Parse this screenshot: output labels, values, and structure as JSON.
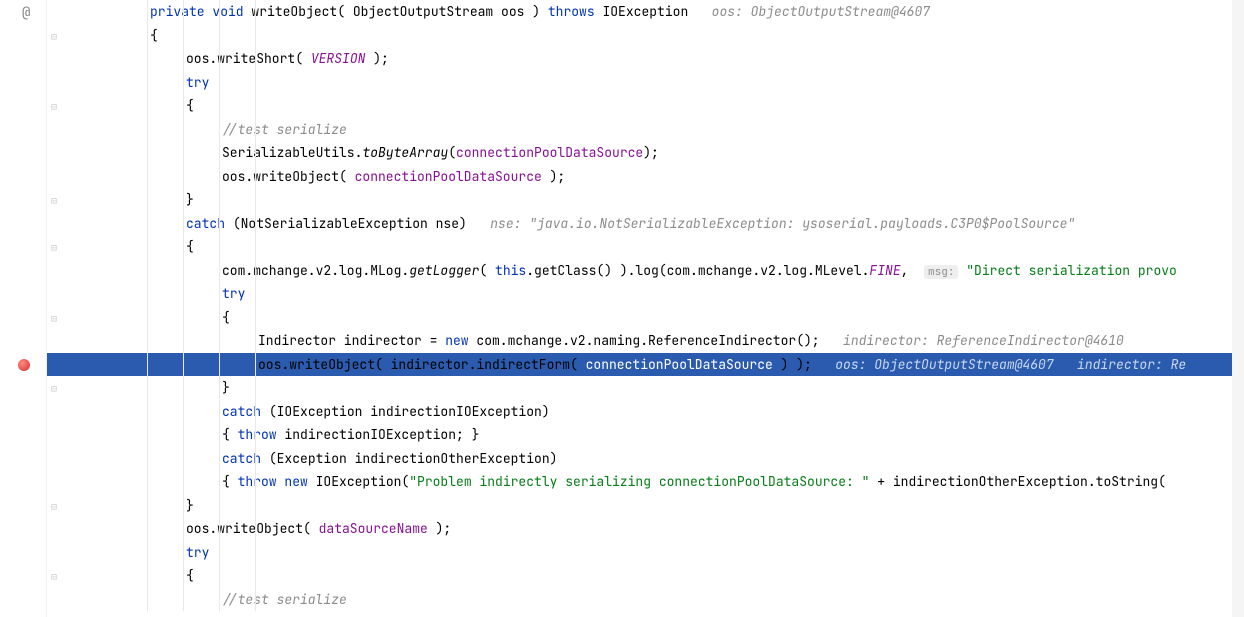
{
  "editor": {
    "lineHeight": 23.5,
    "highlightedLineIndex": 15,
    "breakpointLineIndex": 15,
    "overrideIconLineIndex": 0,
    "foldMarkerLines": [
      1,
      4,
      8,
      10,
      13,
      16,
      21,
      24
    ],
    "lines": [
      {
        "indent": 2,
        "segments": [
          {
            "t": "private ",
            "c": "kw"
          },
          {
            "t": "void ",
            "c": "kw"
          },
          {
            "t": "writeObject",
            "c": "txt"
          },
          {
            "t": "( ObjectOutputStream oos ) ",
            "c": "txt"
          },
          {
            "t": "throws ",
            "c": "kw"
          },
          {
            "t": "IOException   ",
            "c": "txt"
          },
          {
            "t": "oos: ObjectOutputStream@4607",
            "c": "inline-hint"
          }
        ]
      },
      {
        "indent": 2,
        "segments": [
          {
            "t": "{",
            "c": "txt"
          }
        ]
      },
      {
        "indent": 3,
        "segments": [
          {
            "t": "oos.writeShort( ",
            "c": "txt"
          },
          {
            "t": "VERSION",
            "c": "fld-static"
          },
          {
            "t": " );",
            "c": "txt"
          }
        ]
      },
      {
        "indent": 3,
        "segments": [
          {
            "t": "try",
            "c": "kw"
          }
        ]
      },
      {
        "indent": 3,
        "segments": [
          {
            "t": "{",
            "c": "txt"
          }
        ]
      },
      {
        "indent": 4,
        "segments": [
          {
            "t": "//test serialize",
            "c": "cmt"
          }
        ]
      },
      {
        "indent": 4,
        "segments": [
          {
            "t": "SerializableUtils.",
            "c": "txt"
          },
          {
            "t": "toByteArray",
            "c": "mth-static"
          },
          {
            "t": "(",
            "c": "txt"
          },
          {
            "t": "connectionPoolDataSource",
            "c": "fld"
          },
          {
            "t": ");",
            "c": "txt"
          }
        ]
      },
      {
        "indent": 4,
        "segments": [
          {
            "t": "oos.writeObject( ",
            "c": "txt"
          },
          {
            "t": "connectionPoolDataSource",
            "c": "fld"
          },
          {
            "t": " );",
            "c": "txt"
          }
        ]
      },
      {
        "indent": 3,
        "segments": [
          {
            "t": "}",
            "c": "txt"
          }
        ]
      },
      {
        "indent": 3,
        "segments": [
          {
            "t": "catch ",
            "c": "kw"
          },
          {
            "t": "(NotSerializableException nse)   ",
            "c": "txt"
          },
          {
            "t": "nse: \"java.io.NotSerializableException: ysoserial.payloads.C3P0$PoolSource\"",
            "c": "inline-hint"
          }
        ]
      },
      {
        "indent": 3,
        "segments": [
          {
            "t": "{",
            "c": "txt"
          }
        ]
      },
      {
        "indent": 4,
        "segments": [
          {
            "t": "com.mchange.v2.log.MLog.",
            "c": "txt"
          },
          {
            "t": "getLogger",
            "c": "mth-static"
          },
          {
            "t": "( ",
            "c": "txt"
          },
          {
            "t": "this",
            "c": "kw"
          },
          {
            "t": ".getClass() ).log(com.mchange.v2.log.MLevel.",
            "c": "txt"
          },
          {
            "t": "FINE",
            "c": "fld-static"
          },
          {
            "t": ",  ",
            "c": "txt"
          },
          {
            "t": "msg:",
            "c": "param-hint"
          },
          {
            "t": " ",
            "c": "txt"
          },
          {
            "t": "\"Direct serialization provo",
            "c": "str"
          }
        ]
      },
      {
        "indent": 4,
        "segments": [
          {
            "t": "try",
            "c": "kw"
          }
        ]
      },
      {
        "indent": 4,
        "segments": [
          {
            "t": "{",
            "c": "txt"
          }
        ]
      },
      {
        "indent": 5,
        "segments": [
          {
            "t": "Indirector indirector = ",
            "c": "txt"
          },
          {
            "t": "new ",
            "c": "kw"
          },
          {
            "t": "com.mchange.v2.naming.ReferenceIndirector();   ",
            "c": "txt"
          },
          {
            "t": "indirector: ReferenceIndirector@4610",
            "c": "inline-hint"
          }
        ]
      },
      {
        "indent": 5,
        "segments": [
          {
            "t": "oos.writeObject( indirector.indirectForm( ",
            "c": "txt"
          },
          {
            "t": "connectionPoolDataSource",
            "c": "fld"
          },
          {
            "t": " ) );   ",
            "c": "txt"
          },
          {
            "t": "oos: ObjectOutputStream@4607   indirector: Re",
            "c": "inline-hint"
          }
        ]
      },
      {
        "indent": 4,
        "segments": [
          {
            "t": "}",
            "c": "txt"
          }
        ]
      },
      {
        "indent": 4,
        "segments": [
          {
            "t": "catch ",
            "c": "kw"
          },
          {
            "t": "(IOException indirectionIOException)",
            "c": "txt"
          }
        ]
      },
      {
        "indent": 4,
        "segments": [
          {
            "t": "{ ",
            "c": "txt"
          },
          {
            "t": "throw ",
            "c": "kw"
          },
          {
            "t": "indirectionIOException; }",
            "c": "txt"
          }
        ]
      },
      {
        "indent": 4,
        "segments": [
          {
            "t": "catch ",
            "c": "kw"
          },
          {
            "t": "(Exception indirectionOtherException)",
            "c": "txt"
          }
        ]
      },
      {
        "indent": 4,
        "segments": [
          {
            "t": "{ ",
            "c": "txt"
          },
          {
            "t": "throw new ",
            "c": "kw"
          },
          {
            "t": "IOException(",
            "c": "txt"
          },
          {
            "t": "\"Problem indirectly serializing connectionPoolDataSource: \"",
            "c": "str"
          },
          {
            "t": " + indirectionOtherException.toString(",
            "c": "txt"
          }
        ]
      },
      {
        "indent": 3,
        "segments": [
          {
            "t": "}",
            "c": "txt"
          }
        ]
      },
      {
        "indent": 3,
        "segments": [
          {
            "t": "oos.writeObject( ",
            "c": "txt"
          },
          {
            "t": "dataSourceName",
            "c": "fld"
          },
          {
            "t": " );",
            "c": "txt"
          }
        ]
      },
      {
        "indent": 3,
        "segments": [
          {
            "t": "try",
            "c": "kw"
          }
        ]
      },
      {
        "indent": 3,
        "segments": [
          {
            "t": "{",
            "c": "txt"
          }
        ]
      },
      {
        "indent": 4,
        "segments": [
          {
            "t": "//test serialize",
            "c": "cmt"
          }
        ]
      }
    ]
  },
  "icons": {
    "override": "@",
    "foldClose": "⊟"
  }
}
